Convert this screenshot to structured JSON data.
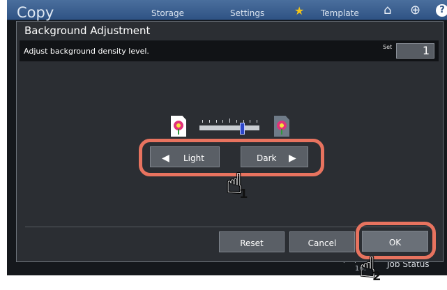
{
  "app": {
    "title": "Copy",
    "tabs": [
      "Storage",
      "Settings",
      "Template"
    ]
  },
  "footer": {
    "datetime": "05/10/20 16:",
    "job_status": "Job Status"
  },
  "dialog": {
    "title": "Background Adjustment",
    "info": "Adjust background density level.",
    "set_label": "Set",
    "set_value": "1",
    "density_level": {
      "position": 5,
      "steps": 9
    },
    "buttons": {
      "light": "Light",
      "dark": "Dark",
      "reset": "Reset",
      "cancel": "Cancel",
      "ok": "OK"
    }
  },
  "annotations": {
    "step1": "1",
    "step2": "2",
    "highlight_color": "#e8735f"
  },
  "icons": [
    "home-icon",
    "globe-icon",
    "help-icon",
    "star-icon",
    "left-arrow-icon",
    "right-arrow-icon",
    "pointing-hand-icon",
    "light-image-icon",
    "dark-image-icon"
  ]
}
